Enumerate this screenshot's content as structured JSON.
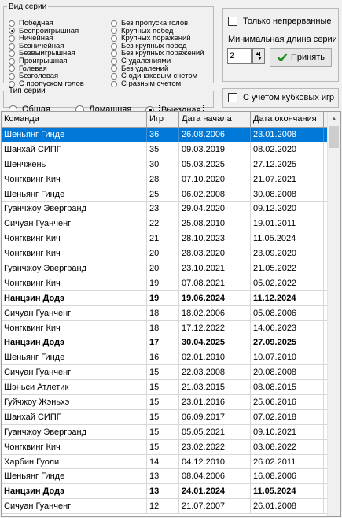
{
  "series_kind": {
    "legend": "Вид серии",
    "left_options": [
      {
        "label": "Победная",
        "checked": false
      },
      {
        "label": "Беспроигрышная",
        "checked": true
      },
      {
        "label": "Ничейная",
        "checked": false
      },
      {
        "label": "Безничейная",
        "checked": false
      },
      {
        "label": "Безвыигрышная",
        "checked": false
      },
      {
        "label": "Проигрышная",
        "checked": false
      },
      {
        "label": "Голевая",
        "checked": false
      },
      {
        "label": "Безголевая",
        "checked": false
      },
      {
        "label": "С пропуском голов",
        "checked": false
      }
    ],
    "right_options": [
      {
        "label": "Без пропуска голов",
        "checked": false
      },
      {
        "label": "Крупных побед",
        "checked": false
      },
      {
        "label": "Крупных поражений",
        "checked": false
      },
      {
        "label": "Без крупных побед",
        "checked": false
      },
      {
        "label": "Без крупных поражений",
        "checked": false
      },
      {
        "label": "С удалениями",
        "checked": false
      },
      {
        "label": "Без удалений",
        "checked": false
      },
      {
        "label": "С одинаковым счетом",
        "checked": false
      },
      {
        "label": "С разным счетом",
        "checked": false
      }
    ]
  },
  "options": {
    "continuous_label": "Только непрерванные",
    "min_length_label": "Минимальная длина серии",
    "min_length_value": "2",
    "apply_label": "Принять"
  },
  "series_type": {
    "legend": "Тип серии",
    "options": [
      {
        "label": "Общая",
        "checked": false
      },
      {
        "label": "Домашняя",
        "checked": false
      },
      {
        "label": "Выездная",
        "checked": true
      }
    ]
  },
  "cup": {
    "label": "С учетом кубковых игр"
  },
  "table": {
    "columns": [
      "Команда",
      "Игр",
      "Дата начала",
      "Дата окончания"
    ],
    "rows": [
      {
        "team": "Шеньянг Гинде",
        "games": "36",
        "start": "26.08.2006",
        "end": "23.01.2008",
        "bold": false,
        "selected": true
      },
      {
        "team": "Шанхай СИПГ",
        "games": "35",
        "start": "09.03.2019",
        "end": "08.02.2020",
        "bold": false,
        "selected": false
      },
      {
        "team": "Шенчжень",
        "games": "30",
        "start": "05.03.2025",
        "end": "27.12.2025",
        "bold": false,
        "selected": false
      },
      {
        "team": "Чонгквинг Кич",
        "games": "28",
        "start": "07.10.2020",
        "end": "21.07.2021",
        "bold": false,
        "selected": false
      },
      {
        "team": "Шеньянг Гинде",
        "games": "25",
        "start": "06.02.2008",
        "end": "30.08.2008",
        "bold": false,
        "selected": false
      },
      {
        "team": "Гуанчжоу Эвергранд",
        "games": "23",
        "start": "29.04.2020",
        "end": "09.12.2020",
        "bold": false,
        "selected": false
      },
      {
        "team": "Сичуан Гуанченг",
        "games": "22",
        "start": "25.08.2010",
        "end": "19.01.2011",
        "bold": false,
        "selected": false
      },
      {
        "team": "Чонгквинг Кич",
        "games": "21",
        "start": "28.10.2023",
        "end": "11.05.2024",
        "bold": false,
        "selected": false
      },
      {
        "team": "Чонгквинг Кич",
        "games": "20",
        "start": "28.03.2020",
        "end": "23.09.2020",
        "bold": false,
        "selected": false
      },
      {
        "team": "Гуанчжоу Эвергранд",
        "games": "20",
        "start": "23.10.2021",
        "end": "21.05.2022",
        "bold": false,
        "selected": false
      },
      {
        "team": "Чонгквинг Кич",
        "games": "19",
        "start": "07.08.2021",
        "end": "05.02.2022",
        "bold": false,
        "selected": false
      },
      {
        "team": "Нанцзин Додэ",
        "games": "19",
        "start": "19.06.2024",
        "end": "11.12.2024",
        "bold": true,
        "selected": false
      },
      {
        "team": "Сичуан Гуанченг",
        "games": "18",
        "start": "18.02.2006",
        "end": "05.08.2006",
        "bold": false,
        "selected": false
      },
      {
        "team": "Чонгквинг Кич",
        "games": "18",
        "start": "17.12.2022",
        "end": "14.06.2023",
        "bold": false,
        "selected": false
      },
      {
        "team": "Нанцзин Додэ",
        "games": "17",
        "start": "30.04.2025",
        "end": "27.09.2025",
        "bold": true,
        "selected": false
      },
      {
        "team": "Шеньянг Гинде",
        "games": "16",
        "start": "02.01.2010",
        "end": "10.07.2010",
        "bold": false,
        "selected": false
      },
      {
        "team": "Сичуан Гуанченг",
        "games": "15",
        "start": "22.03.2008",
        "end": "20.08.2008",
        "bold": false,
        "selected": false
      },
      {
        "team": "Шэньси Атлетик",
        "games": "15",
        "start": "21.03.2015",
        "end": "08.08.2015",
        "bold": false,
        "selected": false
      },
      {
        "team": "Гуйчжоу Жэньхэ",
        "games": "15",
        "start": "23.01.2016",
        "end": "25.06.2016",
        "bold": false,
        "selected": false
      },
      {
        "team": "Шанхай СИПГ",
        "games": "15",
        "start": "06.09.2017",
        "end": "07.02.2018",
        "bold": false,
        "selected": false
      },
      {
        "team": "Гуанчжоу Эвергранд",
        "games": "15",
        "start": "05.05.2021",
        "end": "09.10.2021",
        "bold": false,
        "selected": false
      },
      {
        "team": "Чонгквинг Кич",
        "games": "15",
        "start": "23.02.2022",
        "end": "03.08.2022",
        "bold": false,
        "selected": false
      },
      {
        "team": "Харбин Гуоли",
        "games": "14",
        "start": "04.12.2010",
        "end": "26.02.2011",
        "bold": false,
        "selected": false
      },
      {
        "team": "Шеньянг Гинде",
        "games": "13",
        "start": "08.04.2006",
        "end": "16.08.2006",
        "bold": false,
        "selected": false
      },
      {
        "team": "Нанцзин Додэ",
        "games": "13",
        "start": "24.01.2024",
        "end": "11.05.2024",
        "bold": true,
        "selected": false
      },
      {
        "team": "Сичуан Гуанченг",
        "games": "12",
        "start": "21.07.2007",
        "end": "26.01.2008",
        "bold": false,
        "selected": false
      }
    ]
  }
}
